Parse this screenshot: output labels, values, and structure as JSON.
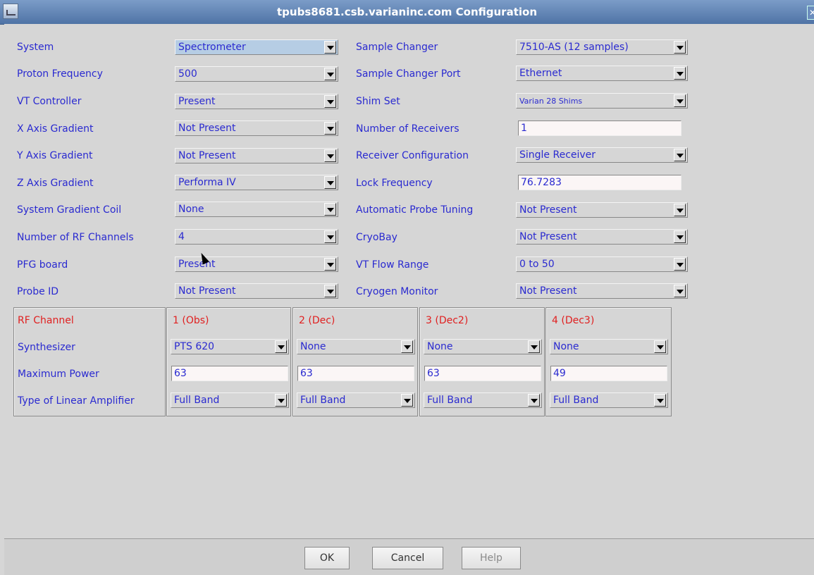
{
  "window": {
    "title": "tpubs8681.csb.varianinc.com Configuration"
  },
  "left_rows": [
    {
      "label": "System",
      "value": "Spectrometer"
    },
    {
      "label": "Proton Frequency",
      "value": "500"
    },
    {
      "label": "VT Controller",
      "value": "Present"
    },
    {
      "label": "X Axis Gradient",
      "value": "Not Present"
    },
    {
      "label": "Y Axis Gradient",
      "value": "Not Present"
    },
    {
      "label": "Z Axis Gradient",
      "value": "Performa IV"
    },
    {
      "label": "System Gradient Coil",
      "value": "None"
    },
    {
      "label": "Number of RF Channels",
      "value": "4"
    },
    {
      "label": "PFG board",
      "value": "Present"
    },
    {
      "label": "Probe ID",
      "value": "Not Present"
    }
  ],
  "right_rows": [
    {
      "label": "Sample Changer",
      "value": "7510-AS (12 samples)"
    },
    {
      "label": "Sample Changer Port",
      "value": "Ethernet"
    },
    {
      "label": "Shim Set",
      "value": "Varian 28 Shims"
    },
    {
      "label": "Number of Receivers",
      "value": "1"
    },
    {
      "label": "Receiver Configuration",
      "value": "Single Receiver"
    },
    {
      "label": "Lock Frequency",
      "value": "76.7283"
    },
    {
      "label": "Automatic Probe Tuning",
      "value": "Not Present"
    },
    {
      "label": "CryoBay",
      "value": "Not Present"
    },
    {
      "label": "VT Flow Range",
      "value": "0 to 50"
    },
    {
      "label": "Cryogen Monitor",
      "value": "Not Present"
    }
  ],
  "rf": {
    "header_label": "RF Channel",
    "row_labels": [
      "Synthesizer",
      "Maximum Power",
      "Type of Linear Amplifier"
    ],
    "channels": [
      {
        "name": "1 (Obs)",
        "synthesizer": "PTS 620",
        "max_power": "63",
        "amplifier": "Full Band"
      },
      {
        "name": "2 (Dec)",
        "synthesizer": "None",
        "max_power": "63",
        "amplifier": "Full Band"
      },
      {
        "name": "3 (Dec2)",
        "synthesizer": "None",
        "max_power": "63",
        "amplifier": "Full Band"
      },
      {
        "name": "4 (Dec3)",
        "synthesizer": "None",
        "max_power": "49",
        "amplifier": "Full Band"
      }
    ]
  },
  "buttons": {
    "ok": "OK",
    "cancel": "Cancel",
    "help": "Help"
  },
  "colors": {
    "label": "#2a2ad0",
    "rf_header": "#e02020",
    "title_bar": "#5a7db0",
    "selected": "#b6cde4"
  }
}
